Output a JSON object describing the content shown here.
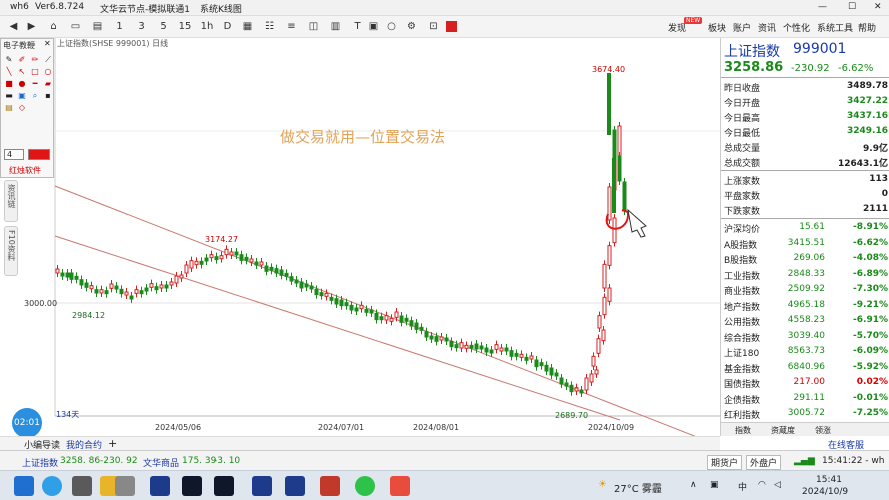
{
  "window": {
    "app_name": "wh6",
    "version": "Ver6.8.724",
    "title": "文华云节点-模拟联通1",
    "subtitle": "系统K线图"
  },
  "toolbar": {
    "icons": [
      "back-icon",
      "forward-icon",
      "1",
      "3",
      "5",
      "15",
      "1h",
      "1d",
      "1w",
      "1m",
      "grid-icon",
      "list-icon",
      "calc-icon",
      "circle-icon",
      "settings-icon",
      "red-square-icon"
    ],
    "right_items": [
      "发现",
      "板块",
      "账户",
      "资讯",
      "个性化",
      "系统工具",
      "帮助"
    ],
    "new_badge": "NEW"
  },
  "palette": {
    "title": "电子教鞭",
    "line_width": "4",
    "software_label": "红烛软件"
  },
  "side_tabs": [
    "资讯链",
    "F10资料"
  ],
  "chart": {
    "header": "上证指数(SHSE 999001)  日线",
    "overlay_title": "做交易就用—位置交易法",
    "price_tick": "3000.00",
    "annotations": {
      "high": "3674.40",
      "peak": "3174.27",
      "low_left": "2984.12",
      "low_right": "2689.70"
    },
    "days_label": "134天",
    "dates": [
      "2024/05/06",
      "2024/07/01",
      "2024/08/01",
      "2024/10/09"
    ]
  },
  "chart_data": {
    "type": "candlestick",
    "title": "上证指数(SHSE 999001)",
    "ticks": [
      "3000.00"
    ],
    "x_ticks": [
      "2024/05/06",
      "2024/07/01",
      "2024/08/01",
      "2024/10/09"
    ],
    "marked_values": [
      3674.4,
      3174.27,
      2984.12,
      2689.7
    ]
  },
  "quote": {
    "name": "上证指数",
    "code": "999001",
    "price": "3258.86",
    "change": "-230.92",
    "change_pct": "-6.62%",
    "fields": [
      {
        "label": "昨日收盘",
        "value": "3489.78"
      },
      {
        "label": "今日开盘",
        "value": "3427.22"
      },
      {
        "label": "今日最高",
        "value": "3437.16"
      },
      {
        "label": "今日最低",
        "value": "3249.16"
      },
      {
        "label": "总成交量",
        "value": "9.9亿"
      },
      {
        "label": "总成交额",
        "value": "12643.1亿"
      }
    ],
    "breadth": [
      {
        "label": "上涨家数",
        "value": "113"
      },
      {
        "label": "平盘家数",
        "value": "0"
      },
      {
        "label": "下跌家数",
        "value": "2111"
      }
    ],
    "indices": [
      {
        "label": "沪深均价",
        "value": "15.61",
        "pct": "-8.91%"
      },
      {
        "label": "A股指数",
        "value": "3415.51",
        "pct": "-6.62%"
      },
      {
        "label": "B股指数",
        "value": "269.06",
        "pct": "-4.08%"
      },
      {
        "label": "工业指数",
        "value": "2848.33",
        "pct": "-6.89%"
      },
      {
        "label": "商业指数",
        "value": "2509.92",
        "pct": "-7.30%"
      },
      {
        "label": "地产指数",
        "value": "4965.18",
        "pct": "-9.21%"
      },
      {
        "label": "公用指数",
        "value": "4558.23",
        "pct": "-6.91%"
      },
      {
        "label": "综合指数",
        "value": "3039.40",
        "pct": "-5.70%"
      },
      {
        "label": "上证180",
        "value": "8563.73",
        "pct": "-6.09%"
      },
      {
        "label": "基金指数",
        "value": "6840.96",
        "pct": "-5.92%"
      },
      {
        "label": "国债指数",
        "value": "217.00",
        "pct": "0.02%"
      },
      {
        "label": "企债指数",
        "value": "291.11",
        "pct": "-0.01%"
      },
      {
        "label": "红利指数",
        "value": "3005.72",
        "pct": "-7.25%"
      }
    ],
    "bottom_tabs": [
      "指数",
      "资蔵度",
      "领涨"
    ]
  },
  "tabs": {
    "items": [
      "小编导读",
      "我的合约"
    ],
    "add": "+",
    "support": "在线客服"
  },
  "status": {
    "idx1_name": "上证指数",
    "idx1_val": "3258. 86",
    "idx1_chg": "-230. 92",
    "idx2_name": "文华商品",
    "idx2_val": "175. 39",
    "idx2_chg": "-3. 10",
    "btn_futures": "期货户",
    "btn_outside": "外盘户",
    "time": "15:41:22 - wh"
  },
  "clock_badge": "02:01",
  "taskbar": {
    "weather": "27°C 雾霾",
    "time": "15:41",
    "date": "2024/10/9"
  }
}
